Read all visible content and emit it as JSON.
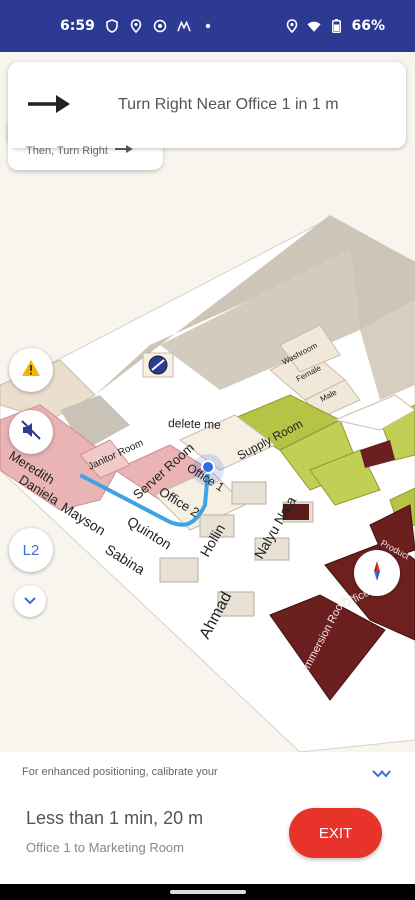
{
  "status_bar": {
    "time": "6:59",
    "battery": "66%",
    "icons": [
      "shield-icon",
      "location-pin-icon",
      "globe-icon",
      "app-icon",
      "dot-icon",
      "location-icon",
      "wifi-icon",
      "battery-icon"
    ]
  },
  "navigation": {
    "instruction": "Turn Right Near Office 1 in 1 m",
    "then": "Then, Turn Right",
    "arrow_icon": "arrow-right-icon"
  },
  "map": {
    "labels": {
      "janitor_room": "Janitor Room",
      "server_room": "Server Room",
      "supply_room": "Supply Room",
      "delete_me": "delete me",
      "office_1": "Office 1",
      "office_2": "Office 2",
      "meredith": "Meredith",
      "daniela": "Daniela",
      "mayson": "Mayson",
      "quinton": "Quinton",
      "sabina": "Sabina",
      "hollin": "Hollin",
      "nalyu_nata": "Nalyu Nata",
      "ahmad": "Ahmad",
      "immersion_room": "Immersion Room",
      "office": "Office",
      "washroom": "Washroom",
      "female": "Female",
      "male": "Male",
      "product": "Product"
    },
    "route_color": "#3ea2e6",
    "current_location_color": "#2f6fe0"
  },
  "controls": {
    "floor_level": "L2",
    "warning_icon": "warning-icon",
    "mute_icon": "volume-off-icon",
    "compass_icon": "compass-icon",
    "floor_down_icon": "chevron-down-icon"
  },
  "calibration": {
    "text": "For enhanced positioning, calibrate your"
  },
  "bottom": {
    "eta": "Less than 1 min, 20 m",
    "route": "Office 1 to Marketing Room",
    "exit_label": "EXIT"
  }
}
